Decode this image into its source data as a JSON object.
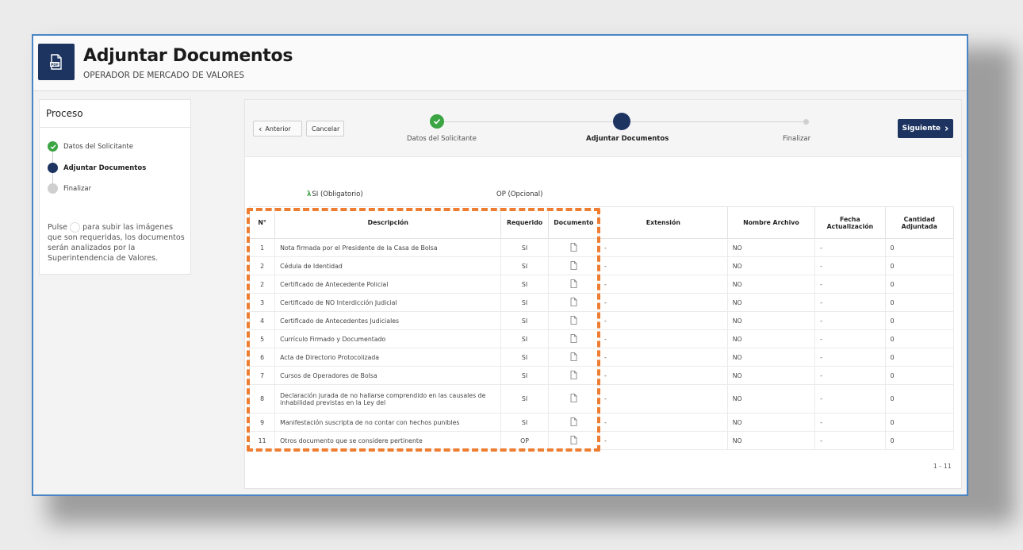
{
  "header": {
    "title": "Adjuntar Documentos",
    "subtitle": "OPERADOR DE MERCADO DE VALORES",
    "icon": "pdf-file-icon"
  },
  "sidebar": {
    "title": "Proceso",
    "steps": [
      {
        "label": "Datos del Solicitante",
        "state": "done"
      },
      {
        "label": "Adjuntar Documentos",
        "state": "active"
      },
      {
        "label": "Finalizar",
        "state": "pending"
      }
    ],
    "help_prefix": "Pulse",
    "help_suffix": "para subir las imágenes que son requeridas, los documentos serán analizados por la Superintendencia de Valores."
  },
  "wizard": {
    "prev_label": "Anterior",
    "cancel_label": "Cancelar",
    "next_label": "Siguiente",
    "steps": [
      {
        "label": "Datos del Solicitante",
        "state": "done"
      },
      {
        "label": "Adjuntar Documentos",
        "state": "active"
      },
      {
        "label": "Finalizar",
        "state": "pending"
      }
    ]
  },
  "legend": {
    "required": "SI (Obligatorio)",
    "optional": "OP (Opcional)"
  },
  "table": {
    "headers": [
      "N°",
      "Descripción",
      "Requerido",
      "Documento",
      "Extensión",
      "Nombre Archivo",
      "Fecha Actualización",
      "Cantidad Adjuntada"
    ],
    "rows": [
      {
        "n": "1",
        "desc": "Nota firmada por el Presidente de la Casa de Bolsa",
        "req": "SI",
        "ext": "-",
        "name": "NO",
        "date": "-",
        "qty": "0"
      },
      {
        "n": "2",
        "desc": "Cédula de Identidad",
        "req": "SI",
        "ext": "-",
        "name": "NO",
        "date": "-",
        "qty": "0"
      },
      {
        "n": "2",
        "desc": "Certificado de Antecedente Policial",
        "req": "SI",
        "ext": "-",
        "name": "NO",
        "date": "-",
        "qty": "0"
      },
      {
        "n": "3",
        "desc": "Certificado de NO Interdicción Judicial",
        "req": "SI",
        "ext": "-",
        "name": "NO",
        "date": "-",
        "qty": "0"
      },
      {
        "n": "4",
        "desc": "Certificado de Antecedentes Judiciales",
        "req": "SI",
        "ext": "-",
        "name": "NO",
        "date": "-",
        "qty": "0"
      },
      {
        "n": "5",
        "desc": "Currículo Firmado y Documentado",
        "req": "SI",
        "ext": "-",
        "name": "NO",
        "date": "-",
        "qty": "0"
      },
      {
        "n": "6",
        "desc": "Acta de Directorio Protocolizada",
        "req": "SI",
        "ext": "-",
        "name": "NO",
        "date": "-",
        "qty": "0"
      },
      {
        "n": "7",
        "desc": "Cursos de Operadores de Bolsa",
        "req": "SI",
        "ext": "-",
        "name": "NO",
        "date": "-",
        "qty": "0"
      },
      {
        "n": "8",
        "desc": "Declaración jurada de no hallarse comprendido en las causales de inhabilidad previstas en la Ley del",
        "req": "SI",
        "ext": "-",
        "name": "NO",
        "date": "-",
        "qty": "0"
      },
      {
        "n": "9",
        "desc": "Manifestación suscripta de no contar con hechos punibles",
        "req": "SI",
        "ext": "-",
        "name": "NO",
        "date": "-",
        "qty": "0"
      },
      {
        "n": "11",
        "desc": "Otros documento que se considere pertinente",
        "req": "OP",
        "ext": "-",
        "name": "NO",
        "date": "-",
        "qty": "0"
      }
    ]
  },
  "pager": "1 - 11",
  "colors": {
    "brand": "#1d3461",
    "success": "#3ba543",
    "highlight": "#ee7d32",
    "window_border": "#4a86c5"
  }
}
